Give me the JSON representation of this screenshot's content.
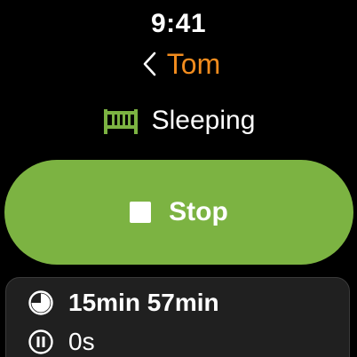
{
  "status_bar": {
    "time": "9:41"
  },
  "header": {
    "title": "Tom",
    "back_icon": "chevron-left-icon"
  },
  "status": {
    "icon": "crib-icon",
    "label": "Sleeping"
  },
  "stop_button": {
    "icon": "stop-icon",
    "label": "Stop"
  },
  "info": {
    "duration": {
      "icon": "pie-clock-icon",
      "value": "15min 57min"
    },
    "paused": {
      "icon": "pause-circle-icon",
      "value": "0s"
    }
  },
  "colors": {
    "background": "#000000",
    "accent_orange": "#f28c1e",
    "accent_green": "#7cb342",
    "card_background": "#202020",
    "text": "#ffffff"
  }
}
